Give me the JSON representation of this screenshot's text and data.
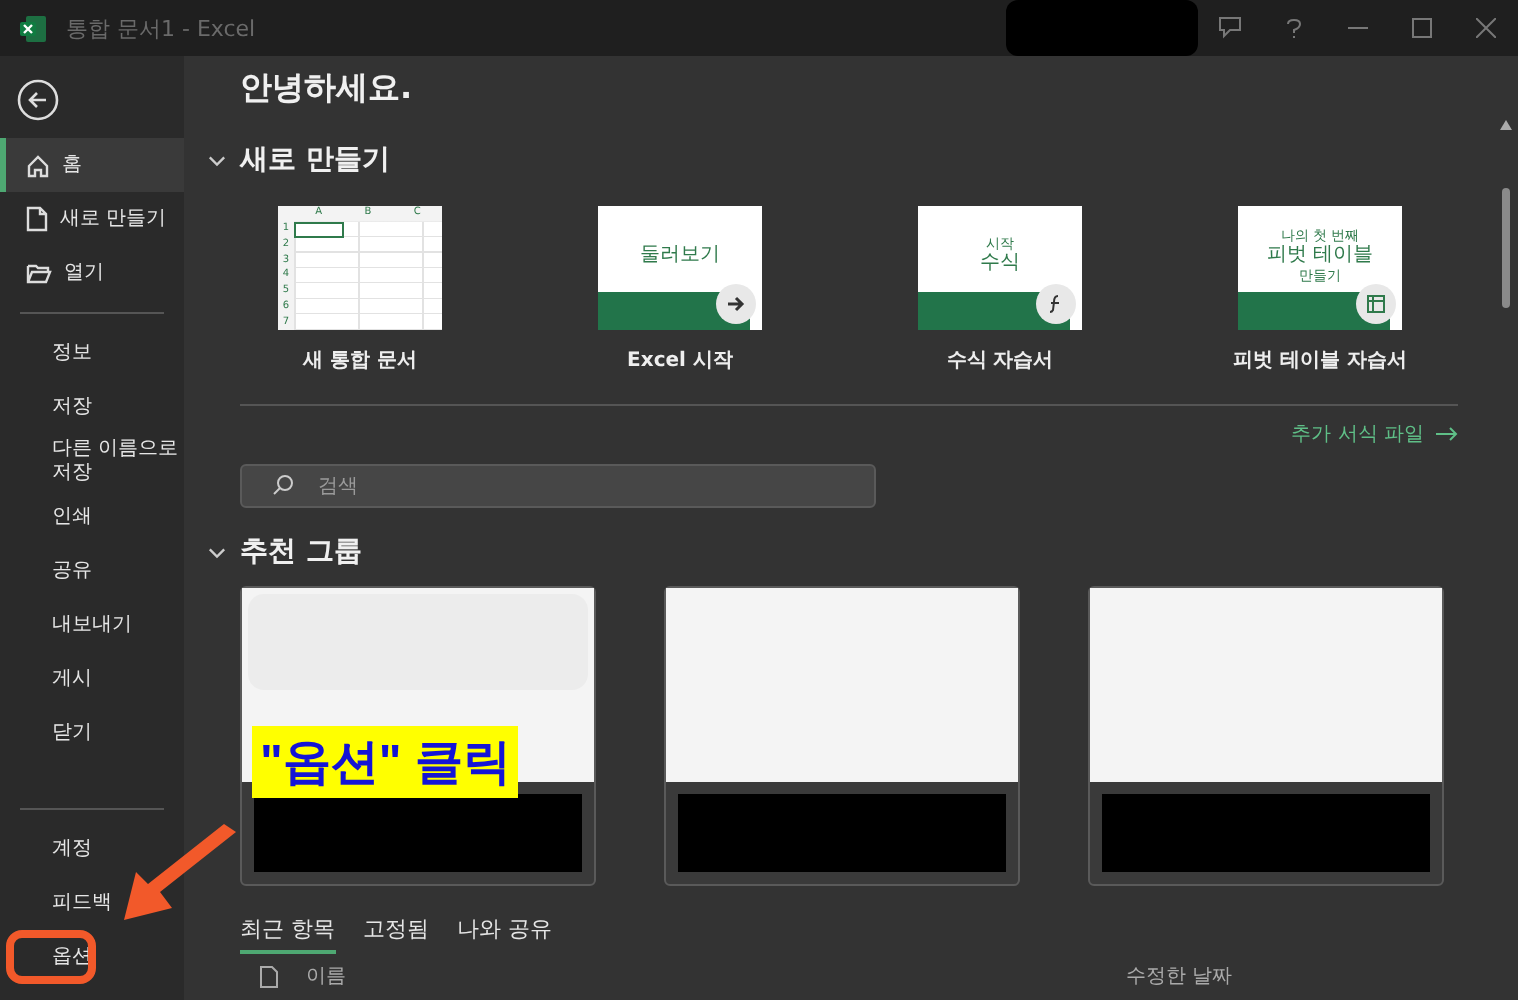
{
  "window": {
    "title": "통합 문서1  -  Excel"
  },
  "sidebar": {
    "top": [
      {
        "label": "홈",
        "selected": true
      },
      {
        "label": "새로 만들기",
        "selected": false
      },
      {
        "label": "열기",
        "selected": false
      }
    ],
    "middle": [
      {
        "label": "정보",
        "selected": false
      },
      {
        "label": "저장",
        "selected": false
      },
      {
        "label": "다른 이름으로 저장",
        "selected": false
      },
      {
        "label": "인쇄",
        "selected": false
      },
      {
        "label": "공유",
        "selected": false
      },
      {
        "label": "내보내기",
        "selected": false
      },
      {
        "label": "게시",
        "selected": false
      },
      {
        "label": "닫기",
        "selected": false
      }
    ],
    "bottom": [
      {
        "label": "계정",
        "selected": false,
        "annotated": false
      },
      {
        "label": "피드백",
        "selected": false,
        "annotated": false
      },
      {
        "label": "옵션",
        "selected": false,
        "annotated": true
      }
    ]
  },
  "greeting": "안녕하세요.",
  "new_section": {
    "title": "새로 만들기",
    "expanded": true,
    "templates": [
      {
        "kind": "blank",
        "label": "새 통합 문서",
        "columns": [
          "A",
          "B",
          "C"
        ],
        "rows": [
          "1",
          "2",
          "3",
          "4",
          "5",
          "6",
          "7"
        ]
      },
      {
        "kind": "tour",
        "label": "Excel 시작",
        "lines": [
          "둘러보기"
        ]
      },
      {
        "kind": "formula",
        "label": "수식 자습서",
        "lines": [
          "시작",
          "수식"
        ]
      },
      {
        "kind": "pivot",
        "label": "피벗 테이블 자습서",
        "lines": [
          "나의 첫 번째",
          "피벗 테이블",
          "만들기"
        ]
      }
    ],
    "more_link": "추가 서식 파일"
  },
  "search": {
    "placeholder": "검색"
  },
  "recommended": {
    "title": "추천 그룹",
    "expanded": true,
    "cards": [
      {
        "kind": "group"
      },
      {
        "kind": "group"
      },
      {
        "kind": "group"
      }
    ]
  },
  "annotation": {
    "label": "\"옵션\" 클릭"
  },
  "file_tabs": [
    {
      "label": "최근 항목",
      "selected": true
    },
    {
      "label": "고정됨",
      "selected": false
    },
    {
      "label": "나와 공유",
      "selected": false
    }
  ],
  "file_list": {
    "columns": [
      "이름",
      "수정한 날짜"
    ]
  }
}
